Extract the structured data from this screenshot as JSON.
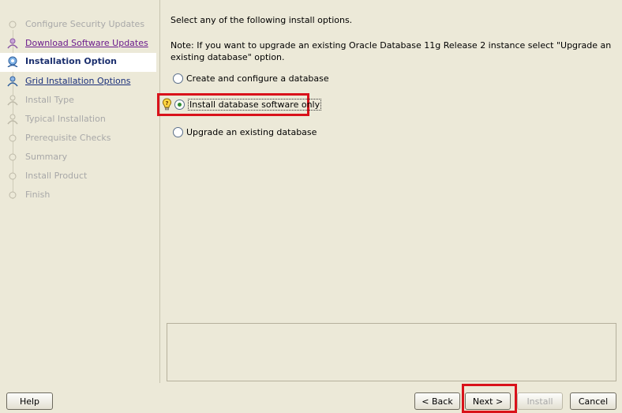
{
  "steps": [
    {
      "label": "Configure Security Updates",
      "state": "disabled"
    },
    {
      "label": "Download Software Updates",
      "state": "visited"
    },
    {
      "label": "Installation Option",
      "state": "current"
    },
    {
      "label": "Grid Installation Options",
      "state": "link"
    },
    {
      "label": "Install Type",
      "state": "disabled"
    },
    {
      "label": "Typical Installation",
      "state": "disabled"
    },
    {
      "label": "Prerequisite Checks",
      "state": "disabled"
    },
    {
      "label": "Summary",
      "state": "disabled"
    },
    {
      "label": "Install Product",
      "state": "disabled"
    },
    {
      "label": "Finish",
      "state": "disabled"
    }
  ],
  "content": {
    "intro": "Select any of the following install options.",
    "note": "Note: If you want to upgrade an existing Oracle Database 11g Release 2 instance select \"Upgrade an existing database\" option.",
    "options": [
      {
        "label": "Create and configure a database",
        "selected": false
      },
      {
        "label": "Install database software only",
        "selected": true
      },
      {
        "label": "Upgrade an existing database",
        "selected": false
      }
    ]
  },
  "footer": {
    "help": "Help",
    "back": "< Back",
    "next": "Next >",
    "install": "Install",
    "cancel": "Cancel"
  },
  "colors": {
    "highlight": "#d9121b",
    "background": "#ece9d8"
  }
}
